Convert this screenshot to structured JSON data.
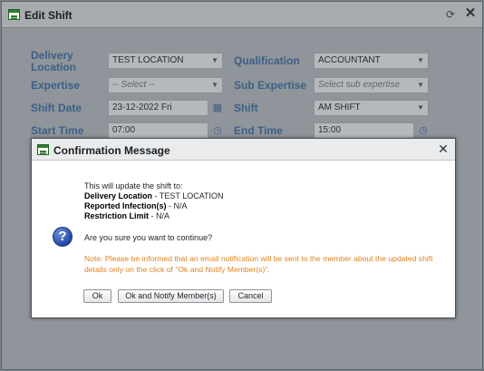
{
  "window": {
    "title": "Edit Shift",
    "refresh_icon": "refresh-icon",
    "close_icon": "close-icon"
  },
  "form": {
    "delivery_location_label_line1": "Delivery",
    "delivery_location_label_line2": "Location",
    "delivery_location_value": "TEST LOCATION",
    "qualification_label": "Qualification",
    "qualification_value": "ACCOUNTANT",
    "expertise_label": "Expertise",
    "expertise_value": "-- Select --",
    "sub_expertise_label": "Sub Expertise",
    "sub_expertise_placeholder": "Select sub expertise",
    "shift_date_label": "Shift Date",
    "shift_date_value": "23-12-2022 Fri",
    "shift_label": "Shift",
    "shift_value": "AM SHIFT",
    "start_time_label": "Start Time",
    "start_time_value": "07:00",
    "end_time_label": "End Time",
    "end_time_value": "15:00"
  },
  "dialog": {
    "title": "Confirmation Message",
    "icon": "question-icon",
    "intro": "This will update the shift to:",
    "delivery_location_key": "Delivery Location",
    "delivery_location_value": " - TEST LOCATION",
    "reported_infections_key": "Reported Infection(s)",
    "reported_infections_value": " - N/A",
    "restriction_limit_key": "Restriction Limit",
    "restriction_limit_value": " - N/A",
    "question": "Are you sure you want to continue?",
    "note": "Note: Please be informed that an email notification will be sent to the member about the updated shift details only on the click of \"Ok and Notify Member(s)\".",
    "buttons": {
      "ok": "Ok",
      "ok_notify": "Ok and Notify Member(s)",
      "cancel": "Cancel"
    }
  },
  "colors": {
    "label_blue": "#3d5f86",
    "note_orange": "#e0821e"
  }
}
